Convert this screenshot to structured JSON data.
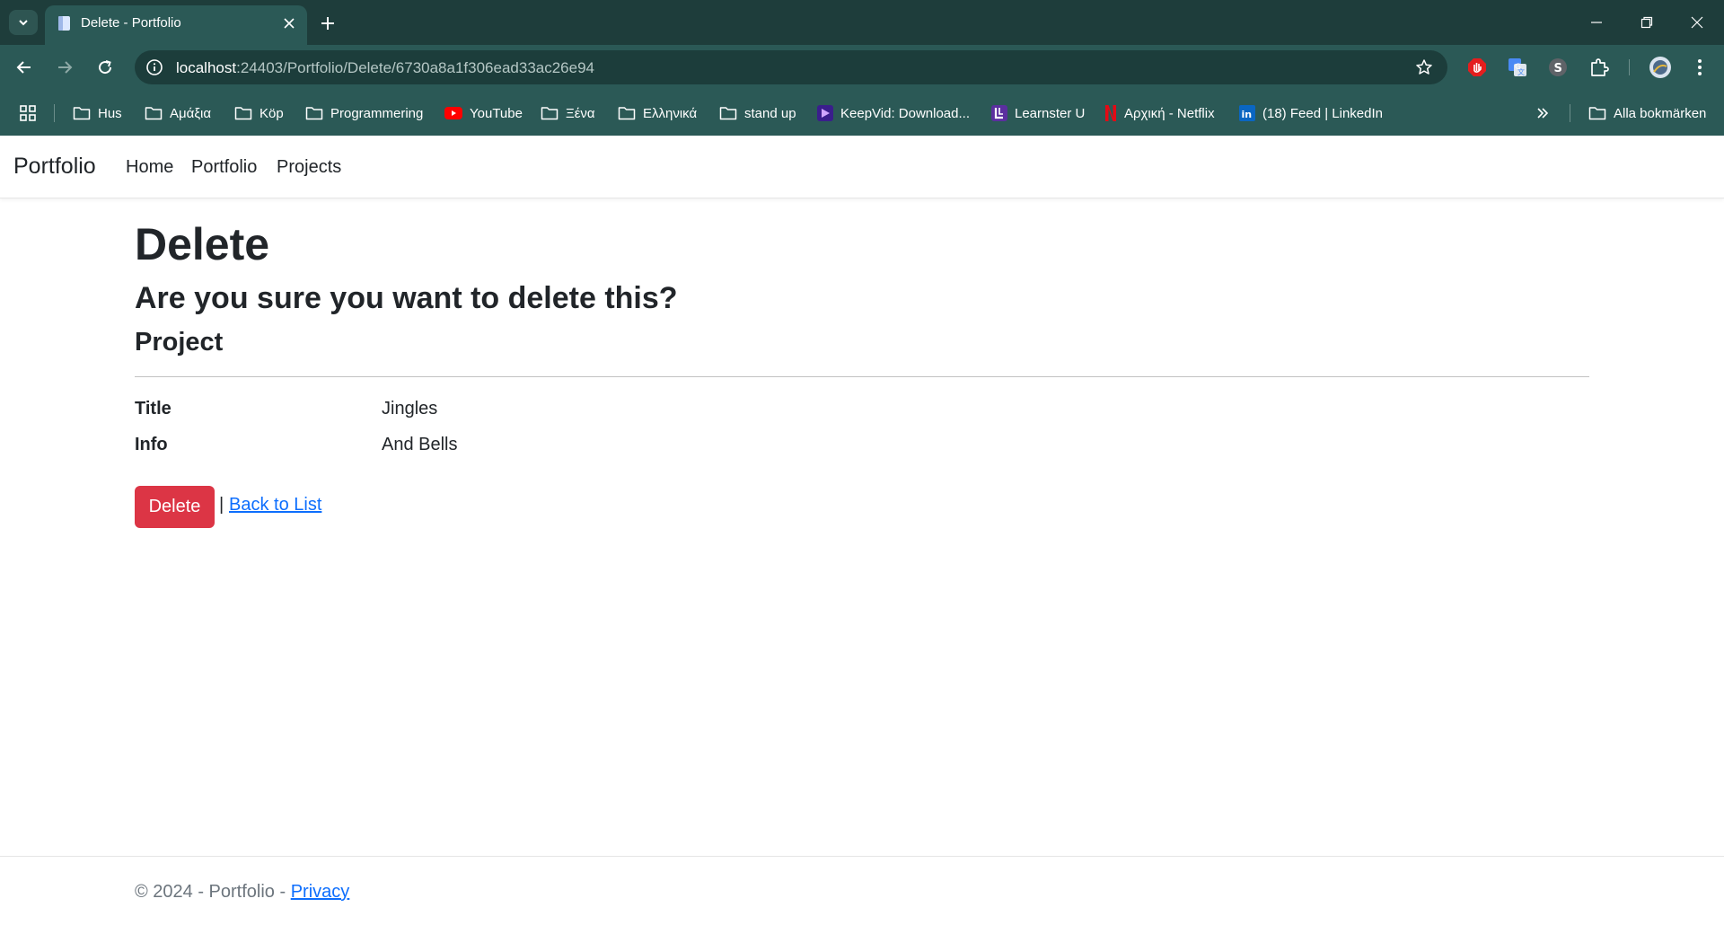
{
  "browser": {
    "tab": {
      "title": "Delete - Portfolio",
      "favicon": "page-icon"
    },
    "url": {
      "host": "localhost",
      "path": ":24403/Portfolio/Delete/6730a8a1f306ead33ac26e94"
    },
    "bookmarks": [
      {
        "label": "Hus",
        "icon": "folder-icon"
      },
      {
        "label": "Αμάξια",
        "icon": "folder-icon"
      },
      {
        "label": "Köp",
        "icon": "folder-icon"
      },
      {
        "label": "Programmering",
        "icon": "folder-icon"
      },
      {
        "label": "YouTube",
        "icon": "youtube-icon"
      },
      {
        "label": "Ξένα",
        "icon": "folder-icon"
      },
      {
        "label": "Ελληνικά",
        "icon": "folder-icon"
      },
      {
        "label": "stand up",
        "icon": "folder-icon"
      },
      {
        "label": "KeepVid: Download...",
        "icon": "keepvid-icon"
      },
      {
        "label": "Learnster U",
        "icon": "learnster-icon"
      },
      {
        "label": "Αρχική - Netflix",
        "icon": "netflix-icon"
      },
      {
        "label": "(18) Feed | LinkedIn",
        "icon": "linkedin-icon"
      }
    ],
    "all_bookmarks_label": "Alla bokmärken",
    "theme_colors": {
      "frame": "#1e3d3b",
      "toolbar": "#2b5956",
      "omnibox": "#1c3d3b"
    }
  },
  "site": {
    "brand": "Portfolio",
    "nav": [
      "Home",
      "Portfolio",
      "Projects"
    ]
  },
  "page": {
    "heading": "Delete",
    "question": "Are you sure you want to delete this?",
    "entity": "Project",
    "fields": [
      {
        "label": "Title",
        "value": "Jingles"
      },
      {
        "label": "Info",
        "value": "And Bells"
      }
    ],
    "delete_button": "Delete",
    "separator": "|",
    "back_link": "Back to List"
  },
  "footer": {
    "text": "© 2024 - Portfolio - ",
    "privacy_link": "Privacy"
  },
  "colors": {
    "danger": "#dc3545",
    "link": "#0d6efd",
    "muted": "#6c757d",
    "text": "#212529"
  }
}
